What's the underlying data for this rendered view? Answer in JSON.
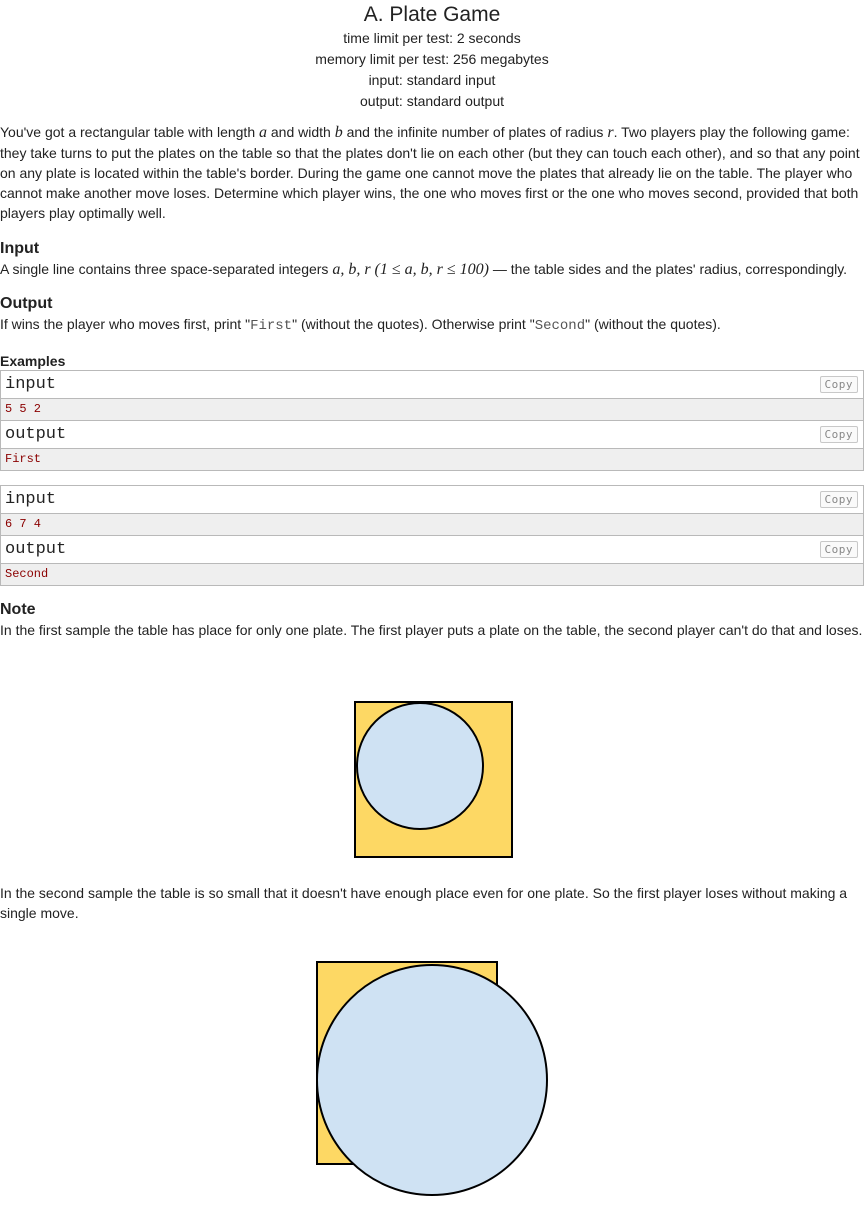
{
  "header": {
    "title": "A. Plate Game",
    "time_limit": "time limit per test: 2 seconds",
    "memory_limit": "memory limit per test: 256 megabytes",
    "input": "input: standard input",
    "output": "output: standard output"
  },
  "statement": {
    "t1": "You've got a rectangular table with length ",
    "var_a": "a",
    "t2": " and width ",
    "var_b": "b",
    "t3": " and the infinite number of plates of radius ",
    "var_r": "r",
    "t4": ". Two players play the following game: they take turns to put the plates on the table so that the plates don't lie on each other (but they can touch each other), and so that any point on any plate is located within the table's border. During the game one cannot move the plates that already lie on the table. The player who cannot make another move loses. Determine which player wins, the one who moves first or the one who moves second, provided that both players play optimally well."
  },
  "input_section": {
    "title": "Input",
    "t1": "A single line contains three space-separated integers ",
    "math": "a, b, r (1 ≤ a, b, r ≤ 100)",
    "t2": " — the table sides and the plates' radius, correspondingly."
  },
  "output_section": {
    "title": "Output",
    "t1": "If wins the player who moves first, print \"",
    "code1": "First",
    "t2": "\" (without the quotes). Otherwise print \"",
    "code2": "Second",
    "t3": "\" (without the quotes)."
  },
  "examples": {
    "title": "Examples",
    "copy_label": "Copy",
    "input_label": "input",
    "output_label": "output",
    "samples": [
      {
        "input": "5 5 2",
        "output": "First"
      },
      {
        "input": "6 7 4",
        "output": "Second"
      }
    ]
  },
  "note": {
    "title": "Note",
    "text1": "In the first sample the table has place for only one plate. The first player puts a plate on the table, the second player can't do that and loses.",
    "text2": "In the second sample the table is so small that it doesn't have enough place even for one plate. So the first player loses without making a single move."
  },
  "colors": {
    "table_fill": "#fdd864",
    "plate_fill": "#cfe2f3",
    "outline": "#000000",
    "sample_output_text": "#8b0000"
  }
}
